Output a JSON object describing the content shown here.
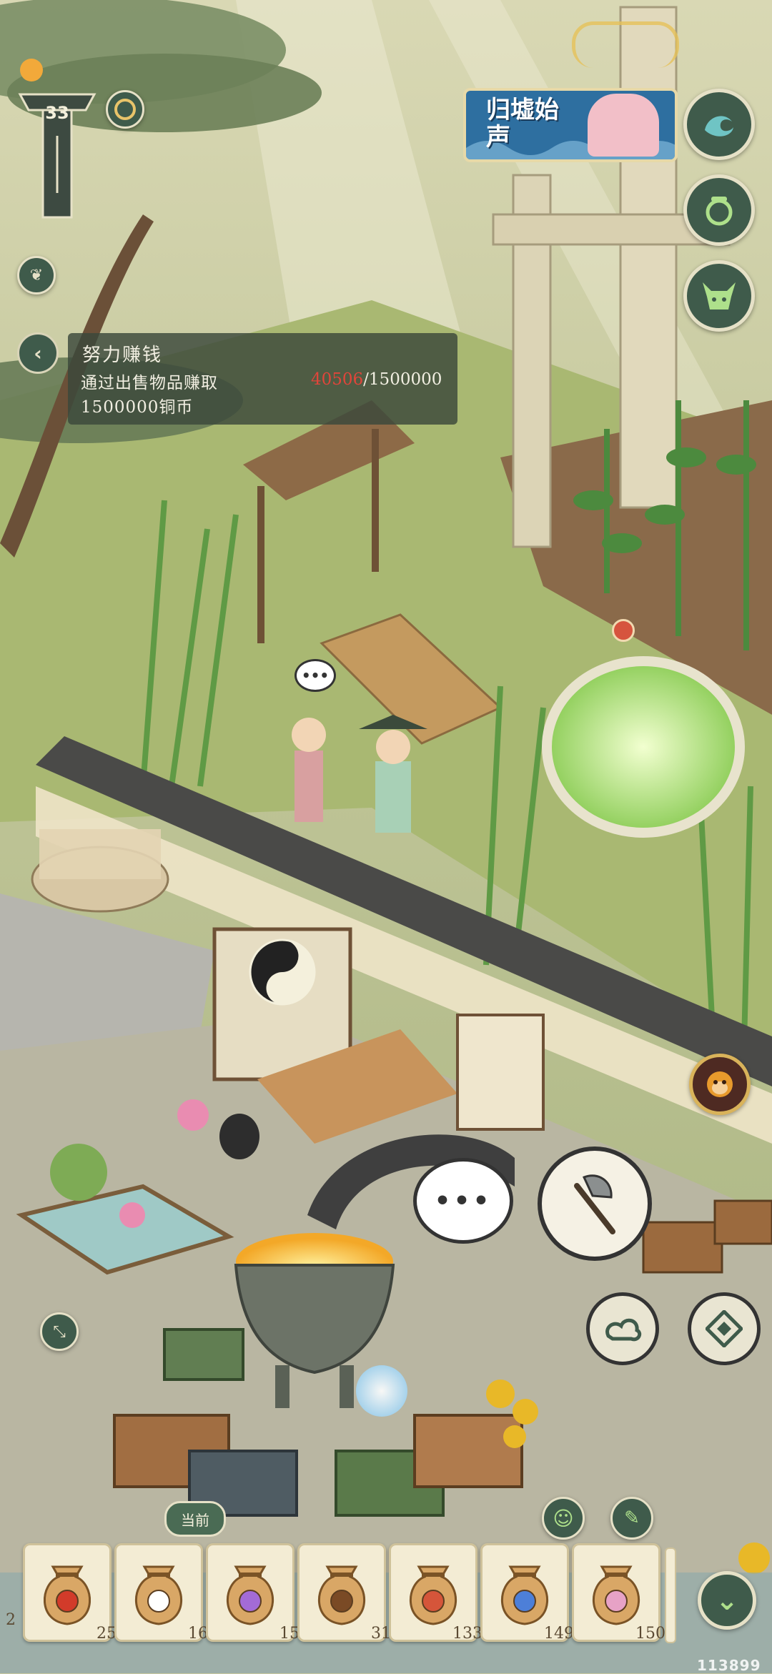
{
  "hud": {
    "level": "33",
    "event_banner_title": "归墟始声"
  },
  "quest": {
    "title": "努力赚钱",
    "description": "通过出售物品赚取",
    "reward_line": "1500000铜币",
    "progress_current": "40506",
    "progress_sep_total": "/1500000"
  },
  "inventory": {
    "current_label": "当前",
    "left_edge_count": "2",
    "slots": [
      {
        "item": "tomato-seed-bag",
        "count": "25"
      },
      {
        "item": "white-flower-seed-bag",
        "count": "16"
      },
      {
        "item": "purple-flower-seed-bag",
        "count": "15"
      },
      {
        "item": "nut-seed-bag",
        "count": "31"
      },
      {
        "item": "mushroom-seed-bag",
        "count": "133"
      },
      {
        "item": "blue-flower-seed-bag",
        "count": "149"
      },
      {
        "item": "pink-flower-seed-bag",
        "count": "150"
      }
    ]
  },
  "watermark": "113899",
  "colors": {
    "button_fill": "#3f5b4b",
    "button_border": "#e6e1c7",
    "quest_panel": "#3a483a",
    "progress_red": "#e0453a",
    "banner_blue": "#2e6fa0"
  },
  "icons": {
    "right_column": [
      "wave-icon",
      "cauldron-icon",
      "ox-demon-icon"
    ],
    "action_buttons": [
      "axe-icon",
      "chat-bubble-icon",
      "cloud-icon",
      "diamond-formation-icon",
      "monkey-face-icon"
    ],
    "small_buttons": [
      "leaf-icon",
      "compass-icon",
      "collapse-arrows-icon",
      "smile-icon",
      "brush-icon",
      "chevron-down-icon"
    ]
  }
}
